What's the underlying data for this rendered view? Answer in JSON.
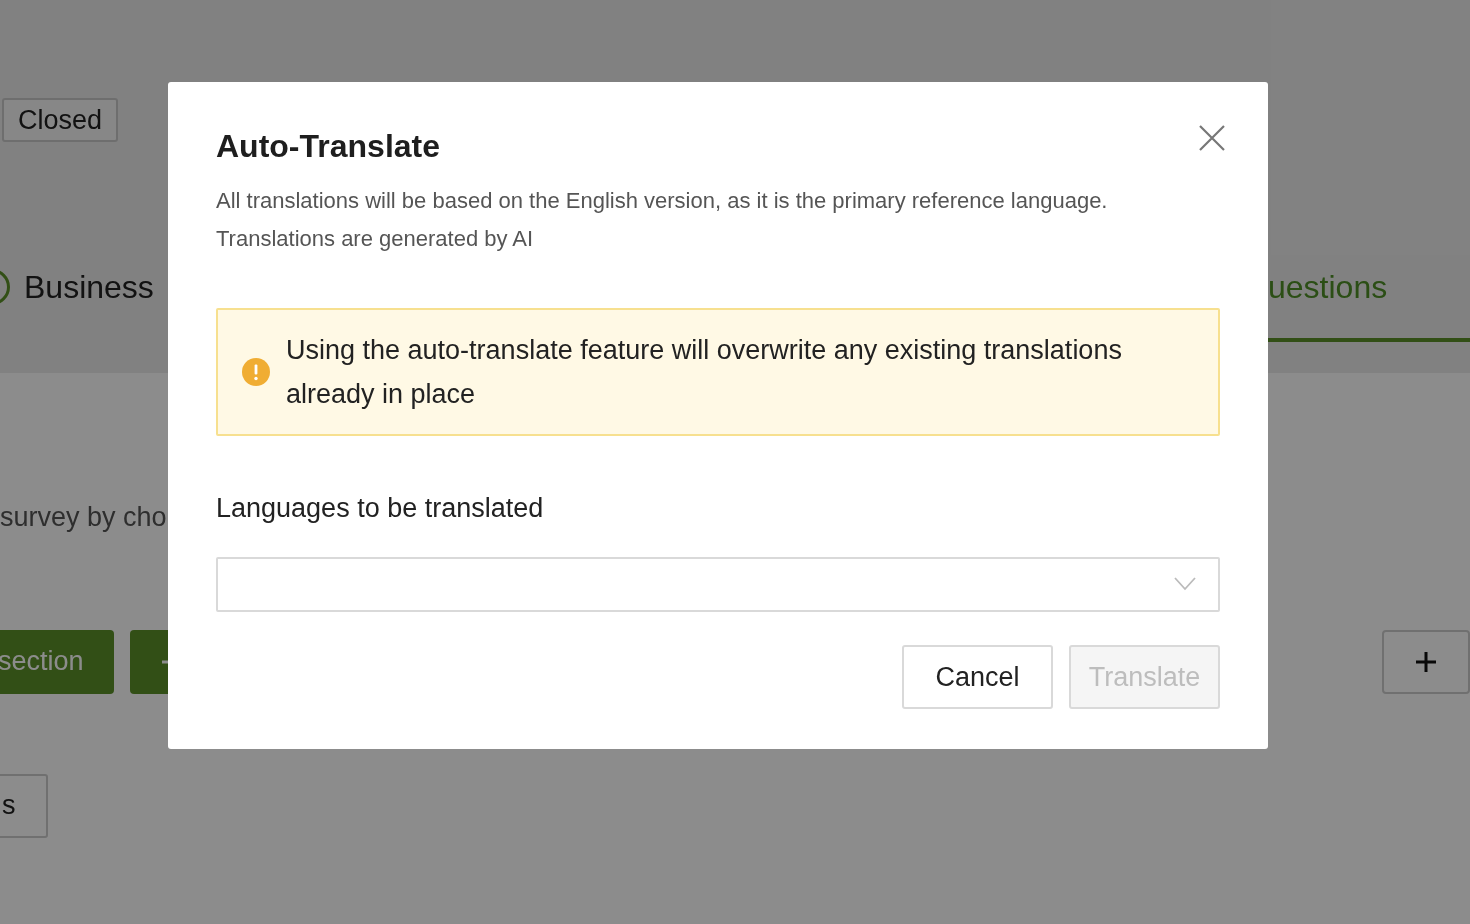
{
  "page": {
    "status_badge": "Closed",
    "tabs": [
      {
        "label": "Business",
        "selected": false
      },
      {
        "label": "uestions",
        "selected": true
      }
    ],
    "intro_text": "survey by cho",
    "action_buttons": [
      {
        "kind": "text",
        "label": "section"
      },
      {
        "kind": "icon"
      },
      {
        "kind": "icon"
      }
    ],
    "secondary_button": {
      "label": "s"
    }
  },
  "dialog": {
    "title": "Auto-Translate",
    "description": [
      "All translations will be based on the English version, as it is the primary reference language.",
      "Translations are generated by AI"
    ],
    "warning": "Using the auto-translate feature will overwrite any existing translations already in place",
    "field_label": "Languages to be translated",
    "buttons": [
      {
        "label": "Cancel",
        "disabled": false
      },
      {
        "label": "Translate",
        "disabled": true
      }
    ]
  }
}
